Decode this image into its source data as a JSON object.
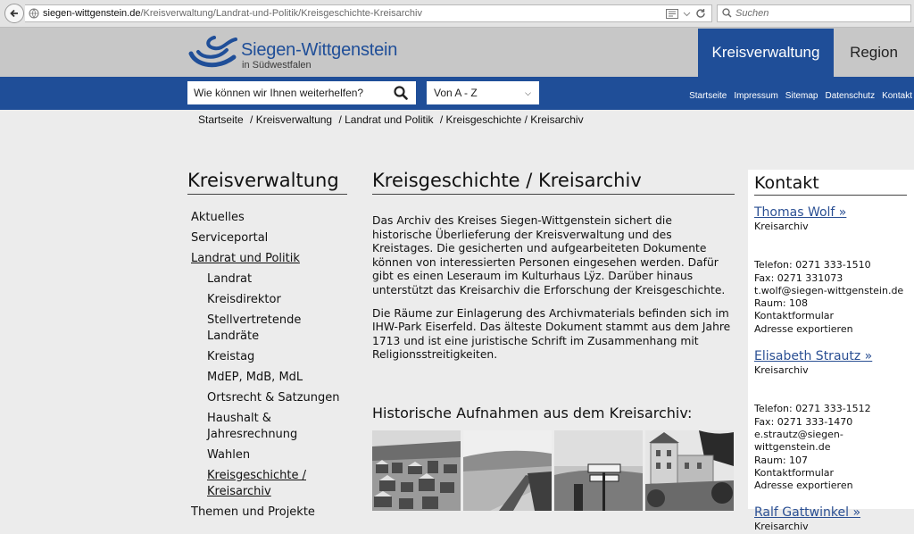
{
  "browser": {
    "url_host": "siegen-wittgenstein.de",
    "url_path": "/Kreisverwaltung/Landrat-und-Politik/Kreisgeschichte-Kreisarchiv",
    "search_placeholder": "Suchen"
  },
  "header": {
    "logo_name": "Siegen-Wittgenstein",
    "logo_sub": "in Südwestfalen",
    "tabs": [
      {
        "label": "Kreisverwaltung",
        "active": true
      },
      {
        "label": "Region",
        "active": false
      }
    ]
  },
  "bluebar": {
    "search_placeholder": "Wie können wir Ihnen weiterhelfen?",
    "az_label": "Von A - Z",
    "links": [
      "Startseite",
      "Impressum",
      "Sitemap",
      "Datenschutz",
      "Kontakt"
    ]
  },
  "breadcrumb": [
    "Startseite",
    "/ Kreisverwaltung",
    "/ Landrat und Politik",
    "/ Kreisgeschichte / Kreisarchiv"
  ],
  "leftnav": {
    "title": "Kreisverwaltung",
    "items": [
      {
        "label": "Aktuelles",
        "level": 1
      },
      {
        "label": "Serviceportal",
        "level": 1
      },
      {
        "label": "Landrat und Politik",
        "level": 1,
        "open": true
      },
      {
        "label": "Landrat",
        "level": 2
      },
      {
        "label": "Kreisdirektor",
        "level": 2
      },
      {
        "label": "Stellvertretende Landräte",
        "level": 2
      },
      {
        "label": "Kreistag",
        "level": 2
      },
      {
        "label": "MdEP, MdB, MdL",
        "level": 2
      },
      {
        "label": "Ortsrecht & Satzungen",
        "level": 2
      },
      {
        "label": "Haushalt & Jahresrechnung",
        "level": 2
      },
      {
        "label": "Wahlen",
        "level": 2
      },
      {
        "label": "Kreisgeschichte / Kreisarchiv",
        "level": 2,
        "active": true
      },
      {
        "label": "Themen und Projekte",
        "level": 1
      }
    ]
  },
  "main": {
    "title": "Kreisgeschichte / Kreisarchiv",
    "paragraphs": [
      "Das Archiv des Kreises Siegen-Wittgenstein sichert die historische Überlieferung der Kreisverwaltung und des Kreistages. Die gesicherten und aufgearbeiteten Dokumente können von interessierten Personen eingesehen werden. Dafür gibt es einen Leseraum im Kulturhaus Lÿz. Darüber hinaus unterstützt das Kreisarchiv die Erforschung der Kreisgeschichte.",
      "Die Räume zur Einlagerung des Archivmaterials befinden sich im IHW-Park Eiserfeld. Das älteste Dokument stammt aus dem Jahre 1713 und ist eine juristische Schrift im Zusammenhang mit Religionsstreitigkeiten."
    ],
    "gallery_title": "Historische Aufnahmen aus dem Kreisarchiv:"
  },
  "contact": {
    "title": "Kontakt",
    "persons": [
      {
        "name": "Thomas Wolf »",
        "dept": "Kreisarchiv",
        "phone": "Telefon: 0271 333-1510",
        "fax": "Fax: 0271 331073",
        "email": "t.wolf@siegen-wittgenstein.de",
        "room": "Raum: 108",
        "form": "Kontaktformular",
        "export": "Adresse exportieren"
      },
      {
        "name": "Elisabeth Strautz »",
        "dept": "Kreisarchiv",
        "phone": "Telefon: 0271 333-1512",
        "fax": "Fax: 0271 333-1470",
        "email": "e.strautz@siegen-wittgenstein.de",
        "room": "Raum: 107",
        "form": "Kontaktformular",
        "export": "Adresse exportieren"
      },
      {
        "name": "Ralf Gattwinkel »",
        "dept": "Kreisarchiv"
      }
    ]
  },
  "colors": {
    "brand_blue": "#1f4e98",
    "header_grey": "#c7c7c7",
    "page_bg": "#ececec"
  }
}
